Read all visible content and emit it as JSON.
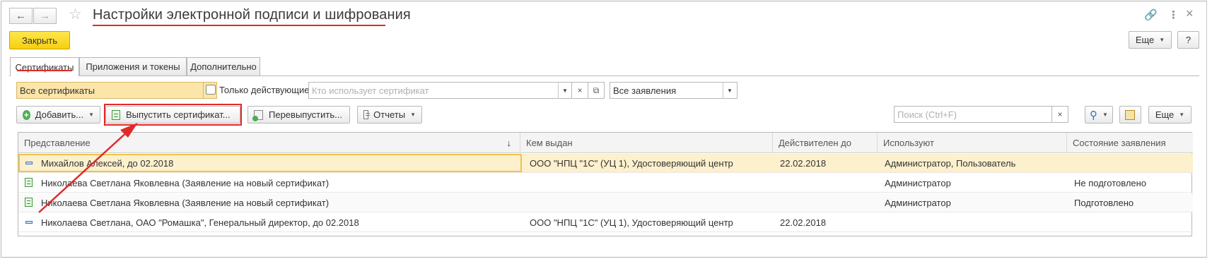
{
  "window": {
    "title": "Настройки электронной подписи и шифрования",
    "back_icon": "←",
    "forward_icon": "→",
    "star_icon": "☆",
    "link_icon": "🔗",
    "more_icon": "⋮",
    "close_icon": "×"
  },
  "toolbar": {
    "close_label": "Закрыть",
    "more_label": "Еще",
    "help_label": "?"
  },
  "tabs": [
    {
      "label": "Сертификаты",
      "active": true
    },
    {
      "label": "Приложения и токены",
      "active": false
    },
    {
      "label": "Дополнительно",
      "active": false
    }
  ],
  "filters": {
    "cert_filter_value": "Все сертификаты",
    "only_valid_label": "Только действующие",
    "user_field_placeholder": "Кто использует сертификат",
    "requests_filter_value": "Все заявления",
    "clear_icon": "×"
  },
  "actions": {
    "add_label": "Добавить...",
    "issue_label": "Выпустить сертификат...",
    "reissue_label": "Перевыпустить...",
    "reports_label": "Отчеты",
    "search_placeholder": "Поиск (Ctrl+F)",
    "search_clear_icon": "×",
    "search_icon": "⚲",
    "more_label": "Еще"
  },
  "table": {
    "columns": [
      "Представление",
      "Кем выдан",
      "Действителен до",
      "Используют",
      "Состояние заявления"
    ],
    "sort_icon": "↓",
    "rows": [
      {
        "type": "cert",
        "name": "Михайлов Алексей, до 02.2018",
        "issuer": "ООО \"НПЦ \"1С\" (УЦ 1), Удостоверяющий центр",
        "valid_to": "22.02.2018",
        "users": "Администратор, Пользователь",
        "status": ""
      },
      {
        "type": "request",
        "name": "Николаева Светлана Яковлевна (Заявление на новый сертификат)",
        "issuer": "",
        "valid_to": "",
        "users": "Администратор",
        "status": "Не подготовлено"
      },
      {
        "type": "request",
        "name": "Николаева Светлана Яковлевна (Заявление на новый сертификат)",
        "issuer": "",
        "valid_to": "",
        "users": "Администратор",
        "status": "Подготовлено"
      },
      {
        "type": "cert",
        "name": "Николаева Светлана, ОАО \"Ромашка\", Генеральный директор, до 02.2018",
        "issuer": "ООО \"НПЦ \"1С\" (УЦ 1), Удостоверяющий центр",
        "valid_to": "22.02.2018",
        "users": "",
        "status": ""
      }
    ]
  },
  "colors": {
    "accent_yellow": "#f5cf12",
    "selection_row": "#fcf0cd",
    "annotation_red": "#e02a2a"
  }
}
